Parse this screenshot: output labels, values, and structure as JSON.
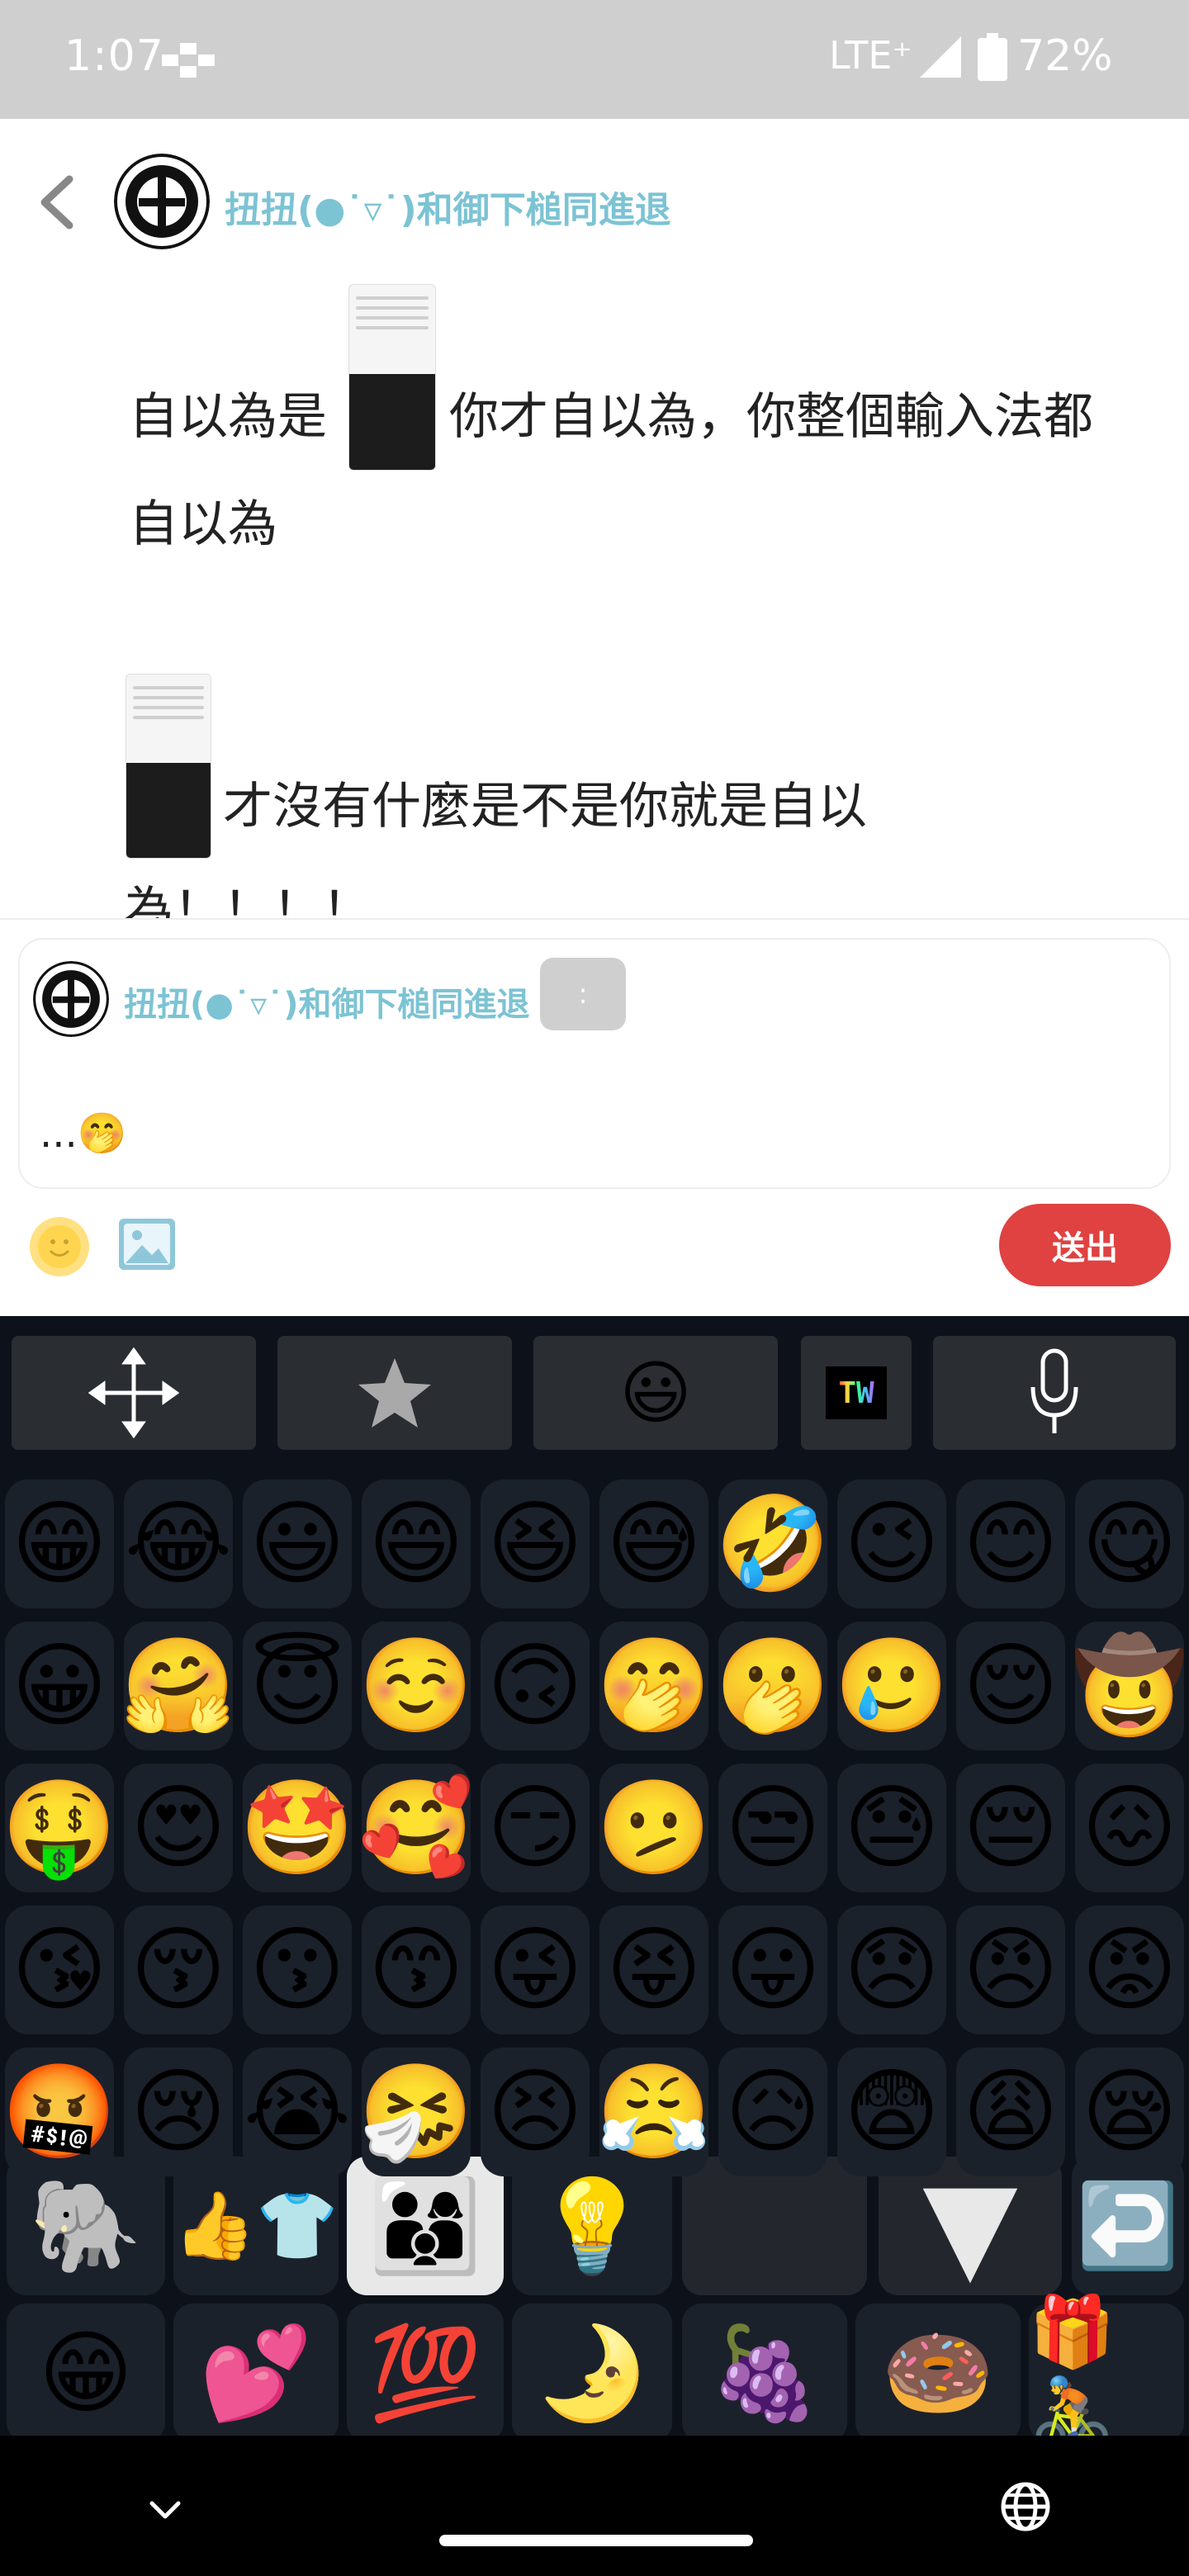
{
  "status_bar": {
    "time": "1:07",
    "network": "LTE⁺",
    "battery": "72%"
  },
  "header": {
    "username": "扭扭(●˙▿˙)和御下槌同進退"
  },
  "post": {
    "line1_a": "自以為是",
    "line1_b": "你才自以為，你整個輸入法都",
    "line2": "自以為",
    "line3": "才沒有什麼是不是你就是自以",
    "line4": "為！！！！"
  },
  "reply": {
    "username": "扭扭(●˙▿˙)和御下槌同進退",
    "colon": ":",
    "text": "...🤭",
    "send_label": "送出"
  },
  "keyboard": {
    "toolbar": {
      "move": "move-arrows-icon",
      "favorites": "star-icon",
      "emoji": "😃",
      "tw": "TW",
      "mic": "microphone-icon"
    },
    "emoji_rows": [
      [
        "😁",
        "😂",
        "😃",
        "😄",
        "😆",
        "😅",
        "🤣",
        "😉",
        "😊",
        "😋"
      ],
      [
        "😀",
        "🤗",
        "😇",
        "☺️",
        "🙃",
        "🤭",
        "🫢",
        "🥲",
        "😌",
        "🤠"
      ],
      [
        "🤑",
        "😍",
        "🤩",
        "🥰",
        "😏",
        "🫤",
        "😒",
        "😓",
        "😔",
        "😖"
      ],
      [
        "😘",
        "😚",
        "😗",
        "😙",
        "😜",
        "😝",
        "😛",
        "😞",
        "😠",
        "😡"
      ],
      [
        "🤬",
        "😢",
        "😭",
        "🤧",
        "😣",
        "😤",
        "😥",
        "😨",
        "😩",
        "😪"
      ]
    ],
    "row6": [
      "🐘",
      "👍👕",
      "👨‍👩‍👦",
      "💡",
      "",
      "▼",
      "↩️"
    ],
    "row7": [
      "😁",
      "💕",
      "💯",
      "🌛",
      "🍇",
      "🍩",
      "🎁🚴"
    ]
  },
  "colors": {
    "username": "#7cc3d4",
    "send": "#e04141",
    "keyboard_bg": "#0d121a",
    "status_bg": "#cfcfcf"
  }
}
